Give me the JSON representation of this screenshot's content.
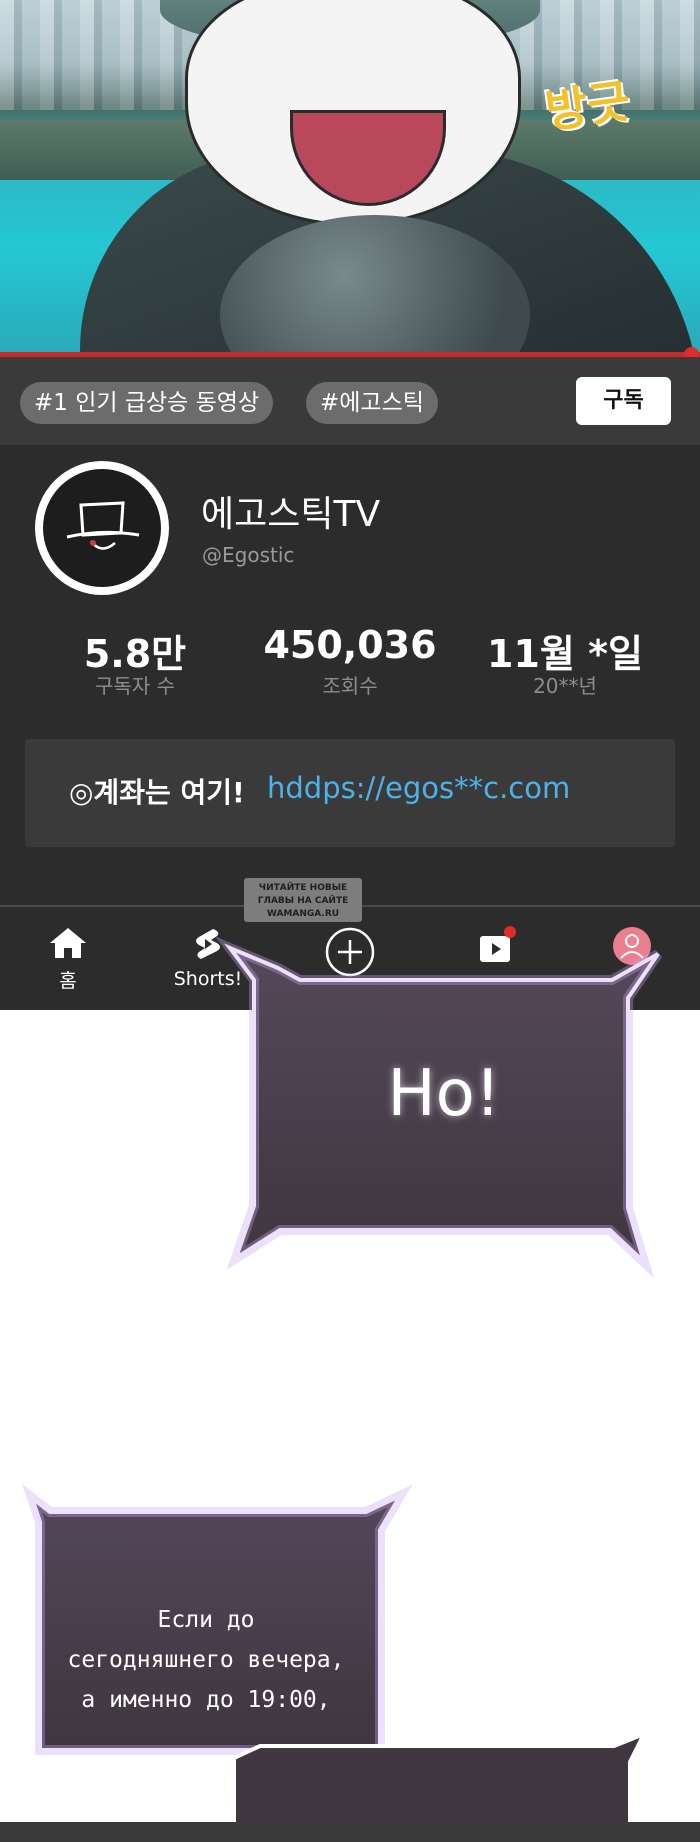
{
  "video": {
    "sound_effect": "방긋",
    "progress": 1.0,
    "progress_color": "#e02b2b"
  },
  "chips": {
    "trending": "#1 인기 급상승 동영상",
    "hashtag": "#에고스틱"
  },
  "subscribe_label": "구독",
  "channel": {
    "name": "에고스틱TV",
    "handle": "@Egostic"
  },
  "stats": [
    {
      "value": "5.8만",
      "label": "구독자 수"
    },
    {
      "value": "450,036",
      "label": "조회수"
    },
    {
      "value": "11월 *일",
      "label": "20**년"
    }
  ],
  "link_box": {
    "label": "◎계좌는 여기!",
    "url": "hddps://egos**c.com",
    "url_color": "#4db2ea"
  },
  "watermark": {
    "line1": "ЧИТАЙТЕ НОВЫЕ",
    "line2": "ГЛАВЫ НА САЙТЕ",
    "line3": "WAMANGA.RU"
  },
  "nav": {
    "home_label": "홈",
    "shorts_label": "Shorts!",
    "home_icon": "home-icon",
    "shorts_icon": "shorts-icon",
    "create_icon": "create-plus-icon",
    "subscriptions_icon": "subscriptions-icon",
    "profile_icon": "profile-icon"
  },
  "dialogue": {
    "bubble1": "Но!",
    "bubble2_line1": "Если до",
    "bubble2_line2": "сегодняшнего вечера,",
    "bubble2_line3": "а именно до 19:00,"
  },
  "colors": {
    "panel_bg": "#2c2c2c",
    "bubble_fill": "#4b4048",
    "bubble_glow": "#c9a6f2"
  }
}
